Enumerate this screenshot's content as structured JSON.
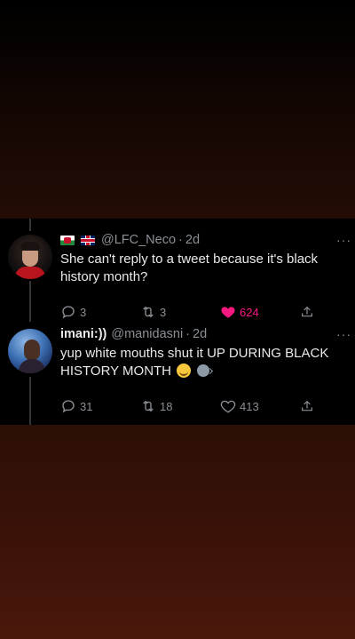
{
  "tweets": [
    {
      "flags": [
        "wales-flag",
        "uk-flag"
      ],
      "display_name": "",
      "handle": "@LFC_Neco",
      "separator": "·",
      "time": "2d",
      "text": "She can't reply to a tweet because it's black history month?",
      "replies": "3",
      "retweets": "3",
      "likes": "624",
      "liked": true,
      "colors": {
        "like": "#f91880"
      }
    },
    {
      "display_name": "imani:))",
      "handle": "@manidasni",
      "separator": "·",
      "time": "2d",
      "text": "yup white mouths shut it UP DURING BLACK HISTORY MONTH",
      "emojis": [
        "grimacing-face-emoji",
        "speaking-head-emoji"
      ],
      "replies": "31",
      "retweets": "18",
      "likes": "413",
      "liked": false
    }
  ],
  "more_label": "···",
  "colors": {
    "background": "#000000",
    "secondary_text": "#8b9096",
    "primary_text": "#e7e9ea",
    "thread_line": "#333639"
  }
}
